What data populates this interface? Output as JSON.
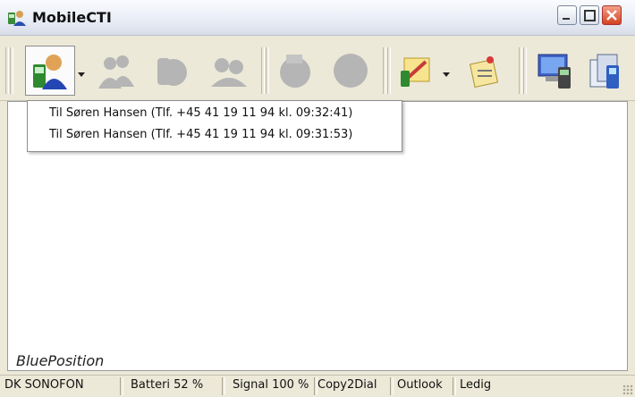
{
  "window": {
    "title": "MobileCTI",
    "controls": [
      "minimize",
      "maximize",
      "close"
    ]
  },
  "toolbar": {
    "buttons": [
      {
        "icon": "contact-phone-icon",
        "state": "pressed",
        "has_dropdown": true
      },
      {
        "icon": "contacts-disabled-icon",
        "state": "disabled"
      },
      {
        "icon": "handset-disabled-icon",
        "state": "disabled"
      },
      {
        "icon": "transfer-disabled-icon",
        "state": "disabled"
      },
      {
        "icon": "mailbox-disabled-icon",
        "state": "disabled"
      },
      {
        "icon": "circle-disabled-icon",
        "state": "disabled"
      },
      {
        "icon": "notepad-phone-icon",
        "state": "enabled",
        "has_dropdown": true
      },
      {
        "icon": "notes-pin-icon",
        "state": "enabled"
      },
      {
        "icon": "computer-phone-icon",
        "state": "enabled"
      },
      {
        "icon": "phone-cards-icon",
        "state": "enabled"
      }
    ]
  },
  "menu": {
    "items": [
      {
        "label": "Til Søren Hansen (Tlf.  +45 41 19 11 94 kl. 09:32:41)"
      },
      {
        "label": "Til Søren Hansen (Tlf.  +45 41 19 11 94 kl. 09:31:53)"
      }
    ]
  },
  "content": {
    "label": "BluePosition"
  },
  "statusbar": {
    "panes": [
      "DK SONOFON",
      "Batteri 52 %",
      "Signal 100 %",
      "Copy2Dial",
      "Outlook",
      "Ledig"
    ]
  },
  "colors": {
    "chrome": "#ece9d8",
    "close_button": "#d4421f",
    "disabled_icon": "#b5b5b5"
  }
}
